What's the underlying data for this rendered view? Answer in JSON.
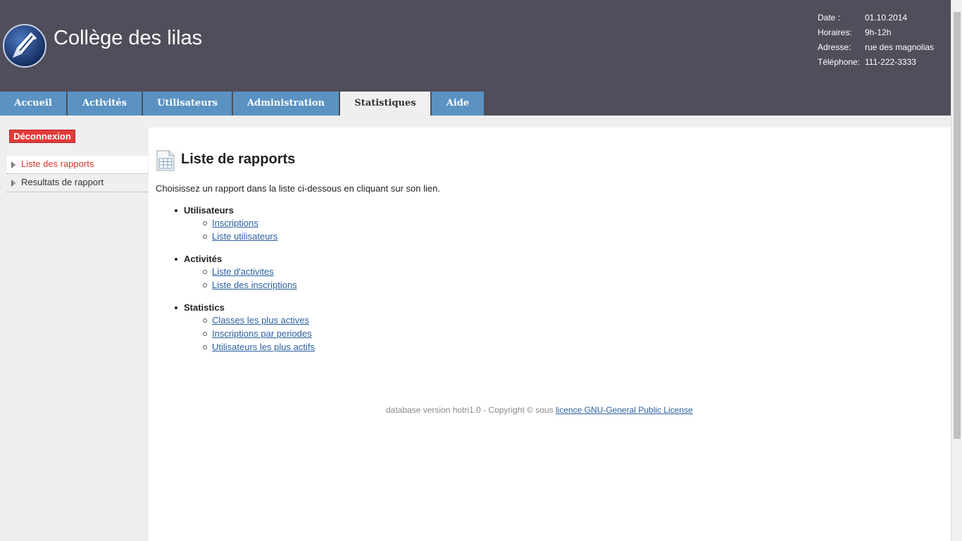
{
  "header": {
    "title": "Collège des lilas",
    "info": [
      {
        "label": "Date :",
        "value": "01.10.2014"
      },
      {
        "label": "Horaires:",
        "value": "9h-12h"
      },
      {
        "label": "Adresse:",
        "value": "rue des magnolias"
      },
      {
        "label": "Téléphone:",
        "value": "111-222-3333"
      }
    ]
  },
  "tabs": [
    {
      "label": "Accueil"
    },
    {
      "label": "Activités"
    },
    {
      "label": "Utilisateurs"
    },
    {
      "label": "Administration"
    },
    {
      "label": "Statistiques"
    },
    {
      "label": "Aide"
    }
  ],
  "sidebar": {
    "logout_label": "Déconnexion",
    "items": [
      {
        "label": "Liste des rapports"
      },
      {
        "label": "Resultats de rapport"
      }
    ]
  },
  "main": {
    "title": "Liste de rapports",
    "intro": "Choisissez un rapport dans la liste ci-dessous en cliquant sur son lien.",
    "groups": [
      {
        "title": "Utilisateurs",
        "links": [
          "Inscriptions",
          "Liste utilisateurs"
        ]
      },
      {
        "title": "Activités",
        "links": [
          "Liste d'activites",
          "Liste des inscriptions"
        ]
      },
      {
        "title": "Statistics",
        "links": [
          "Classes les plus actives",
          "Inscriptions par periodes",
          "Utilisateurs les plus actifs"
        ]
      }
    ]
  },
  "footer": {
    "text": "database version hotri1.0 - Copyright © sous",
    "link": "licence GNU-General Public License"
  },
  "colors": {
    "header_bg": "#4f4e5a",
    "tab_bg": "#5b92c2",
    "logout_bg": "#e23b3b",
    "active_link": "#d9342c",
    "link": "#2b5f9e"
  }
}
